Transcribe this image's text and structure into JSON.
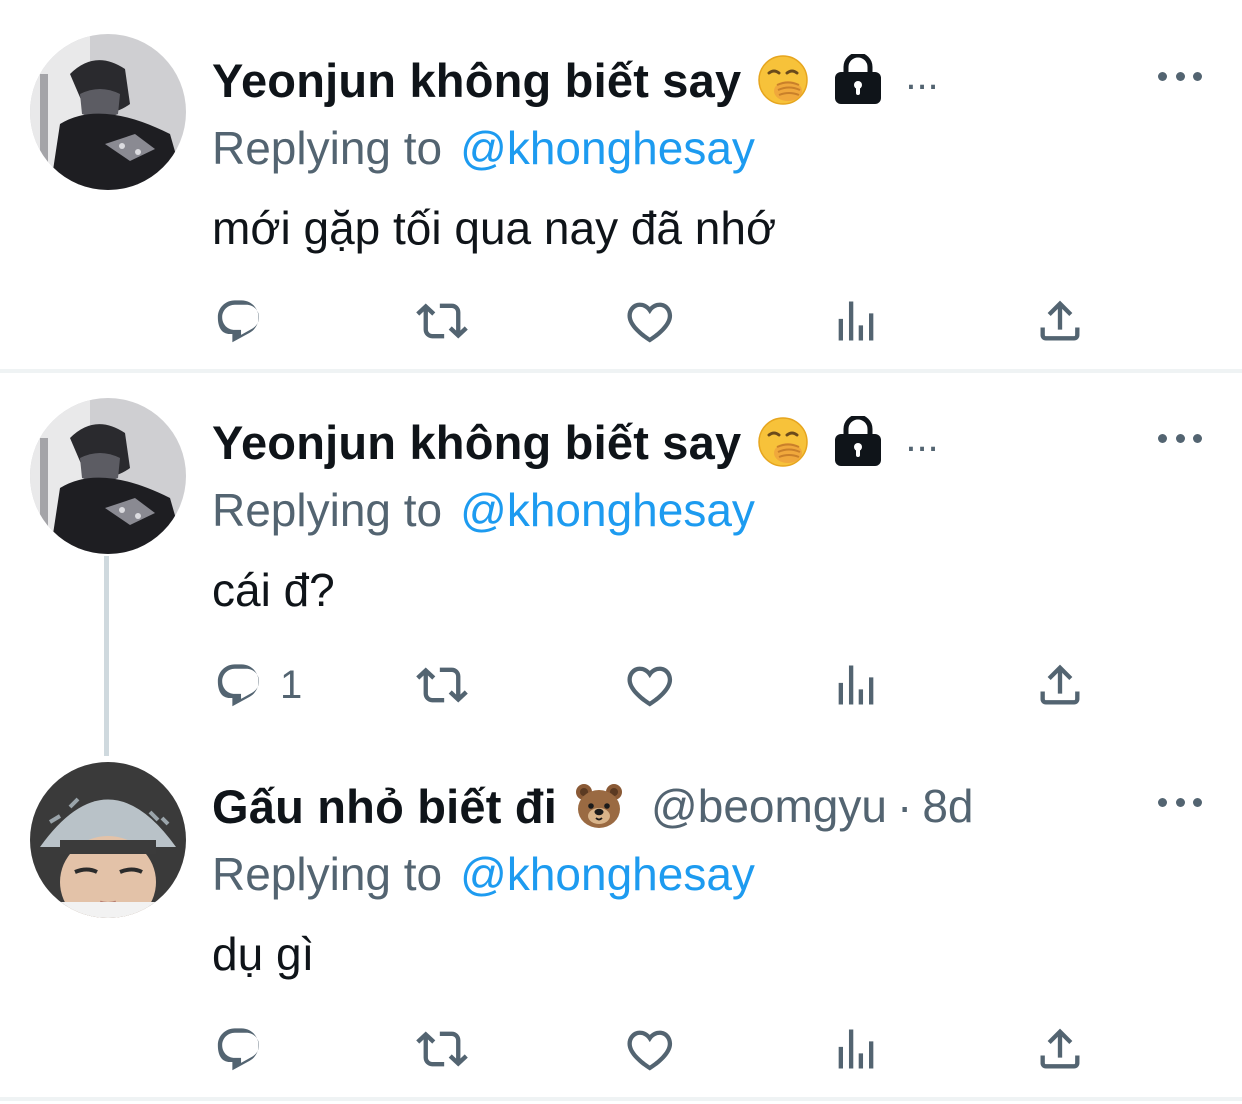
{
  "tweets": [
    {
      "author_name": "Yeonjun không biết say",
      "name_emoji_icon": "hand-over-mouth-emoji-icon",
      "protected_icon": "lock-icon",
      "name_overflow": "...",
      "replying_prefix": "Replying to",
      "replying_to": "@khonghesay",
      "text": "mới gặp tối qua nay đã nhớ",
      "reply_count": ""
    },
    {
      "author_name": "Yeonjun không biết say",
      "name_emoji_icon": "hand-over-mouth-emoji-icon",
      "protected_icon": "lock-icon",
      "name_overflow": "...",
      "replying_prefix": "Replying to",
      "replying_to": "@khonghesay",
      "text": "cái đ?",
      "reply_count": "1"
    },
    {
      "author_name": "Gấu nhỏ biết đi",
      "name_emoji_icon": "bear-face-emoji-icon",
      "handle": "@beomgyu",
      "separator": "·",
      "timestamp": "8d",
      "replying_prefix": "Replying to",
      "replying_to": "@khonghesay",
      "text": "dụ gì",
      "reply_count": ""
    }
  ],
  "action_icons": [
    "reply-icon",
    "retweet-icon",
    "like-icon",
    "views-icon",
    "share-icon"
  ],
  "colors": {
    "text_primary": "#0f1419",
    "text_secondary": "#536471",
    "link": "#1d9bf0",
    "divider": "#eff3f4",
    "thread_line": "#cfd9de"
  }
}
